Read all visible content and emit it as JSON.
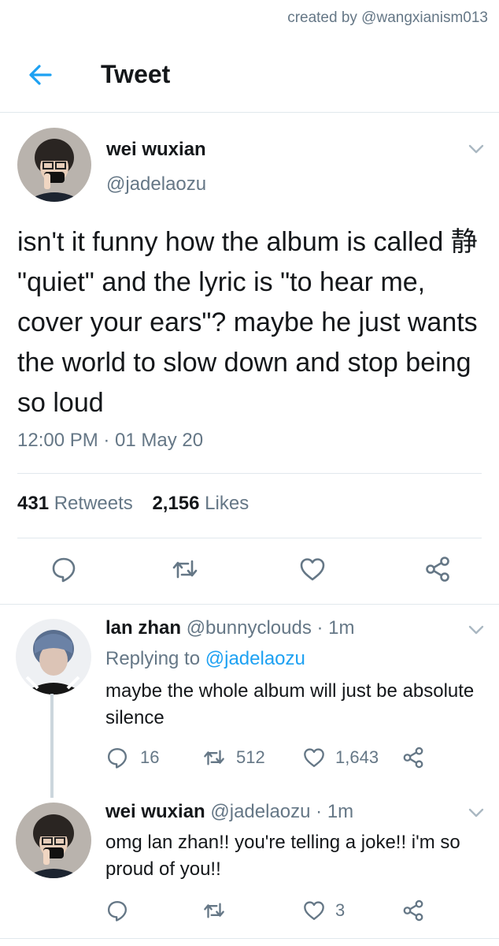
{
  "credit": "created by @wangxianism013",
  "header": {
    "title": "Tweet"
  },
  "main_tweet": {
    "name": "wei wuxian",
    "handle": "@jadelaozu",
    "text": "isn't it funny how the album is called 静 \"quiet\" and the lyric is \"to hear me, cover your ears\"? maybe he just wants the world to slow down and stop being so loud",
    "timestamp": "12:00 PM · 01 May 20",
    "retweets_count": "431",
    "retweets_label": "Retweets",
    "likes_count": "2,156",
    "likes_label": "Likes"
  },
  "reply1": {
    "name": "lan zhan",
    "handle_time": "@bunnyclouds · 1m",
    "replying_prefix": "Replying to",
    "replying_handle": "@jadelaozu",
    "text": "maybe the whole album will just be absolute silence",
    "replies": "16",
    "retweets": "512",
    "likes": "1,643"
  },
  "reply2": {
    "name": "wei wuxian",
    "handle_time": "@jadelaozu · 1m",
    "text": "omg lan zhan!! you're telling a joke!! i'm so proud of you!!",
    "likes": "3"
  },
  "icons": {
    "back": "arrow-left-icon",
    "reply": "reply-icon",
    "retweet": "retweet-icon",
    "like": "heart-icon",
    "share": "share-icon",
    "more": "chevron-down-icon"
  },
  "colors": {
    "accent": "#1da1f2",
    "secondary_text": "#657786",
    "divider": "#e1e8ed"
  }
}
